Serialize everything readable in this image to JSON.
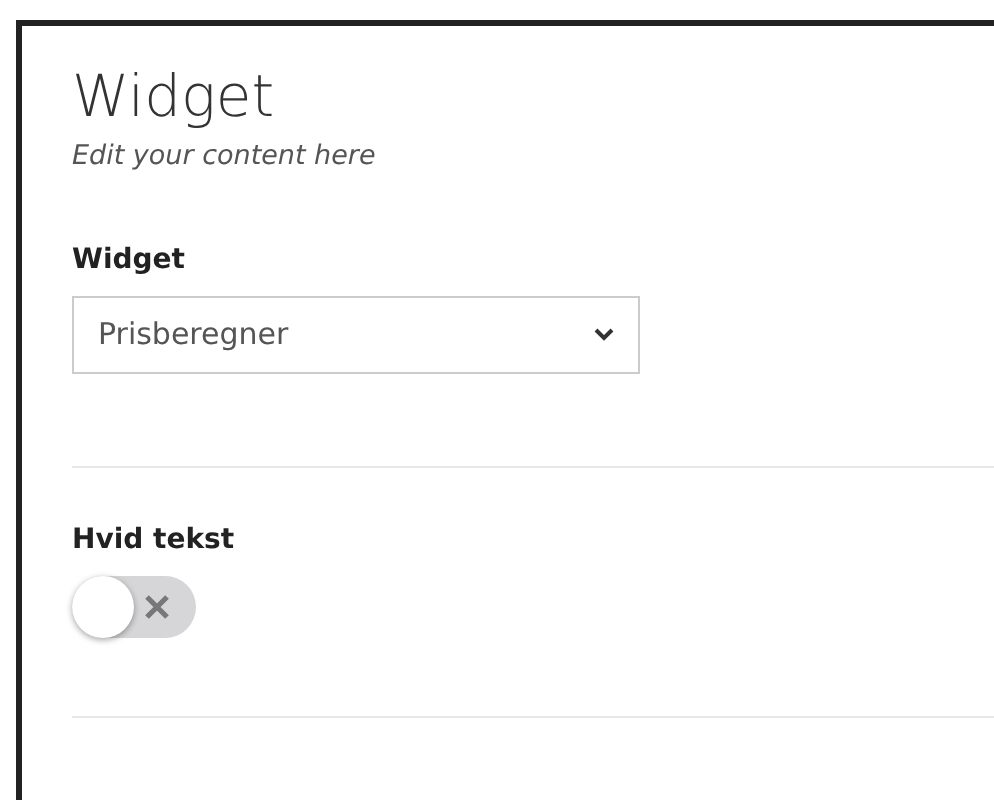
{
  "panel": {
    "title": "Widget",
    "subtitle": "Edit your content here"
  },
  "fields": [
    {
      "kind": "select",
      "label": "Widget",
      "value": "Prisberegner"
    },
    {
      "kind": "toggle",
      "label": "Hvid tekst",
      "on": false
    }
  ]
}
